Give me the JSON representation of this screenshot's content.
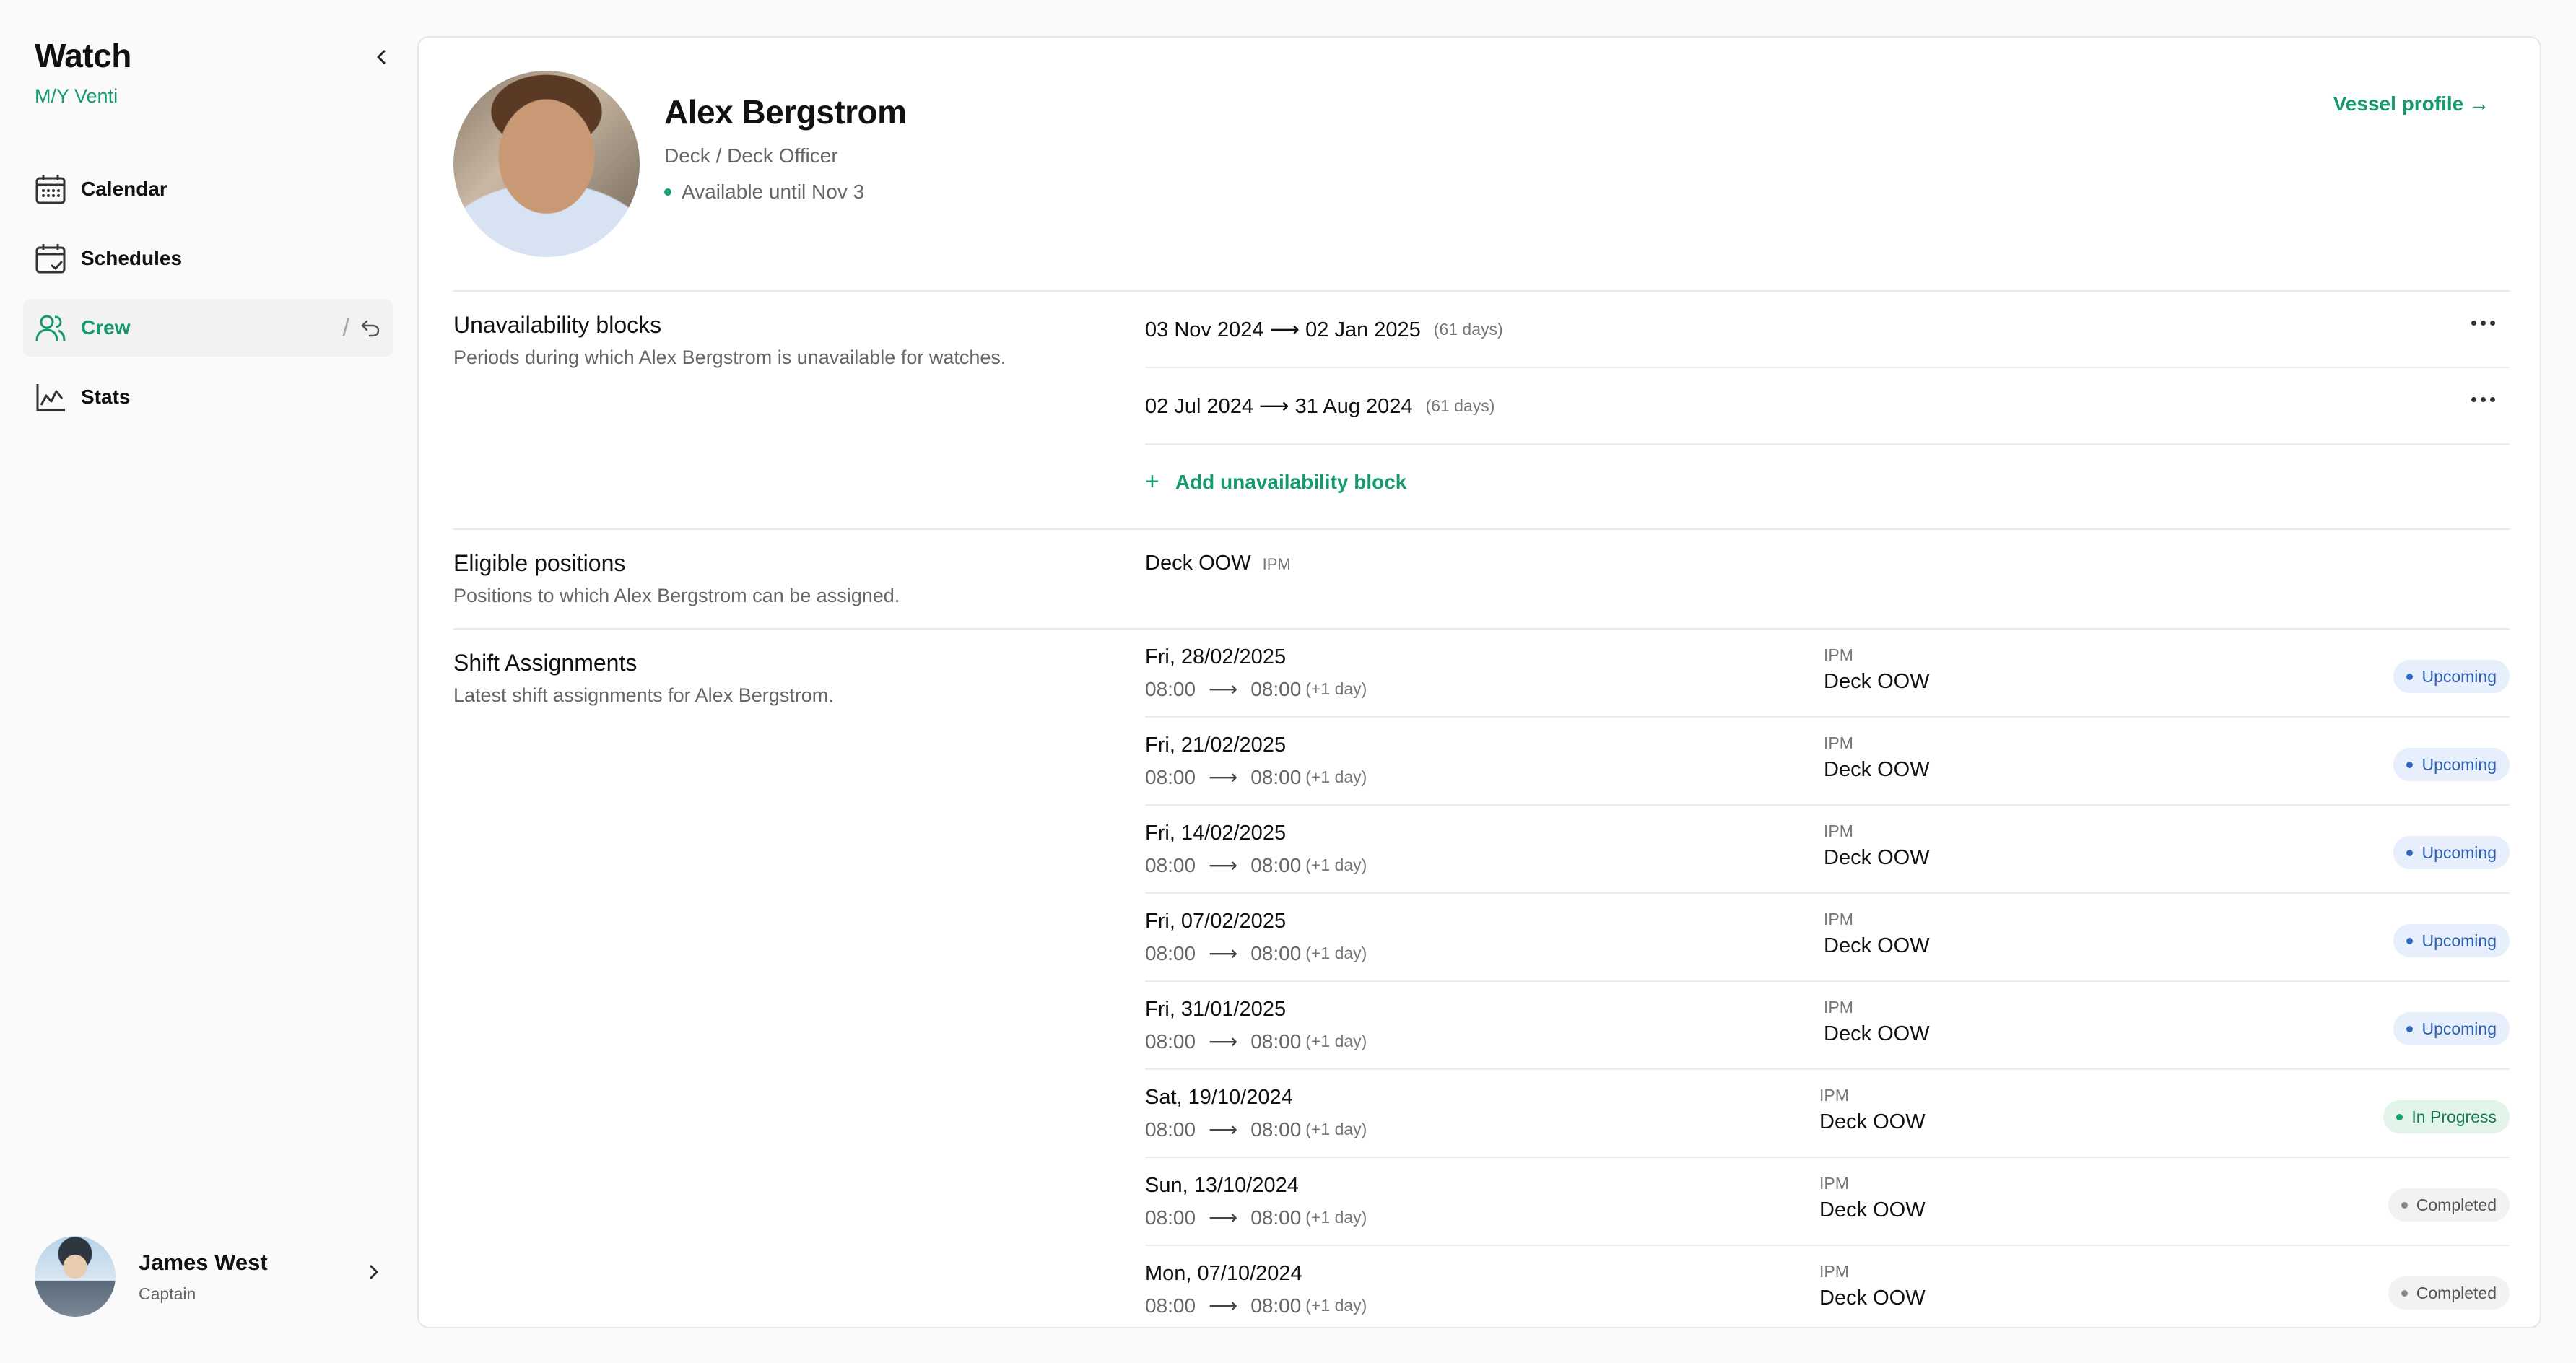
{
  "sidebar": {
    "title": "Watch",
    "vessel": "M/Y Venti",
    "items": [
      {
        "label": "Calendar",
        "icon": "calendar-icon"
      },
      {
        "label": "Schedules",
        "icon": "calendar-check-icon"
      },
      {
        "label": "Crew",
        "icon": "users-icon",
        "active": true
      },
      {
        "label": "Stats",
        "icon": "chart-icon"
      }
    ],
    "crew_slash": "/",
    "user": {
      "name": "James West",
      "role": "Captain"
    }
  },
  "profile": {
    "name": "Alex Bergstrom",
    "department": "Deck / Deck Officer",
    "availability": "Available until Nov 3",
    "vessel_link": "Vessel profile →"
  },
  "unavailability": {
    "title": "Unavailability blocks",
    "description": "Periods during which Alex Bergstrom is unavailable for watches.",
    "blocks": [
      {
        "range": "03 Nov 2024 ⟶ 02 Jan 2025",
        "days": "(61 days)"
      },
      {
        "range": "02 Jul 2024 ⟶ 31 Aug 2024",
        "days": "(61 days)"
      }
    ],
    "add_label": "Add unavailability block"
  },
  "positions": {
    "title": "Eligible positions",
    "description": "Positions to which Alex Bergstrom can be assigned.",
    "items": [
      {
        "name": "Deck OOW",
        "tag": "IPM"
      }
    ]
  },
  "shifts": {
    "title": "Shift Assignments",
    "description": "Latest shift assignments for Alex Bergstrom.",
    "items": [
      {
        "date": "Fri, 28/02/2025",
        "start": "08:00",
        "end": "08:00",
        "plus": "(+1 day)",
        "tag": "IPM",
        "position": "Deck OOW",
        "status": "Upcoming"
      },
      {
        "date": "Fri, 21/02/2025",
        "start": "08:00",
        "end": "08:00",
        "plus": "(+1 day)",
        "tag": "IPM",
        "position": "Deck OOW",
        "status": "Upcoming"
      },
      {
        "date": "Fri, 14/02/2025",
        "start": "08:00",
        "end": "08:00",
        "plus": "(+1 day)",
        "tag": "IPM",
        "position": "Deck OOW",
        "status": "Upcoming"
      },
      {
        "date": "Fri, 07/02/2025",
        "start": "08:00",
        "end": "08:00",
        "plus": "(+1 day)",
        "tag": "IPM",
        "position": "Deck OOW",
        "status": "Upcoming"
      },
      {
        "date": "Fri, 31/01/2025",
        "start": "08:00",
        "end": "08:00",
        "plus": "(+1 day)",
        "tag": "IPM",
        "position": "Deck OOW",
        "status": "Upcoming"
      },
      {
        "date": "Sat, 19/10/2024",
        "start": "08:00",
        "end": "08:00",
        "plus": "(+1 day)",
        "tag": "IPM",
        "position": "Deck OOW",
        "status": "In Progress"
      },
      {
        "date": "Sun, 13/10/2024",
        "start": "08:00",
        "end": "08:00",
        "plus": "(+1 day)",
        "tag": "IPM",
        "position": "Deck OOW",
        "status": "Completed"
      },
      {
        "date": "Mon, 07/10/2024",
        "start": "08:00",
        "end": "08:00",
        "plus": "(+1 day)",
        "tag": "IPM",
        "position": "Deck OOW",
        "status": "Completed"
      }
    ]
  },
  "colors": {
    "accent": "#159a6c",
    "upcoming": "#2f5fb0",
    "in_progress": "#167a4e",
    "completed": "#555555"
  }
}
